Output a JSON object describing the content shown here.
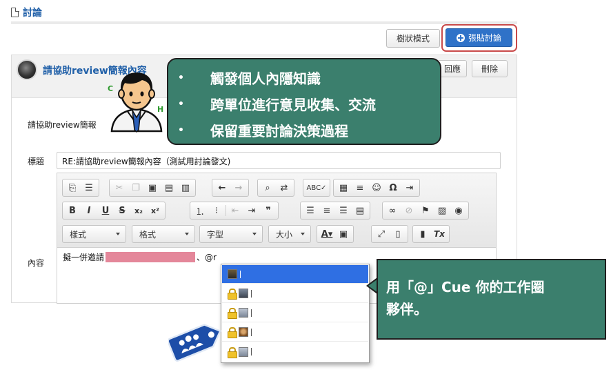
{
  "page": {
    "title": "討論"
  },
  "actions": {
    "tree_view": "樹狀模式",
    "post": "張貼討論"
  },
  "post": {
    "title": "請協助review簡報內容",
    "reply": "回應",
    "delete": "刪除",
    "body_prefix": "請協助review簡報",
    "green_fragment_1": "C",
    "green_fragment_2": "H"
  },
  "form": {
    "subject_label": "標題",
    "subject_value": "RE:請協助review簡報內容（測試用討論發文)",
    "content_label": "內容",
    "content_prefix": "擬一併邀請",
    "content_suffix": "、@r"
  },
  "editor": {
    "style_combo": "樣式",
    "format_combo": "格式",
    "font_combo": "字型",
    "size_combo": "大小",
    "bold": "B",
    "italic": "I",
    "underline": "U",
    "strike": "S",
    "subscript": "x₂",
    "superscript": "x²",
    "quote": "❞",
    "omega": "Ω",
    "remove_format": "Tx"
  },
  "callouts": {
    "top_points": [
      "觸發個人內隱知識",
      "跨單位進行意見收集、交流",
      "保留重要討論決策過程"
    ],
    "side_line1": "用「@」Cue 你的工作圈",
    "side_line2": "夥伴。"
  },
  "mention_list": {
    "count": 5
  },
  "colors": {
    "accent_blue": "#2f72c8",
    "callout_green": "#3b7f6d",
    "highlight_frame": "#c94a4a",
    "selected_row": "#2f6fe3",
    "redaction": "#e4879a"
  },
  "icons": [
    "document-icon",
    "plus-circle-icon",
    "user-avatar-icon",
    "lock-icon",
    "mascot-businessman-icon",
    "company-tag-logo-icon"
  ]
}
